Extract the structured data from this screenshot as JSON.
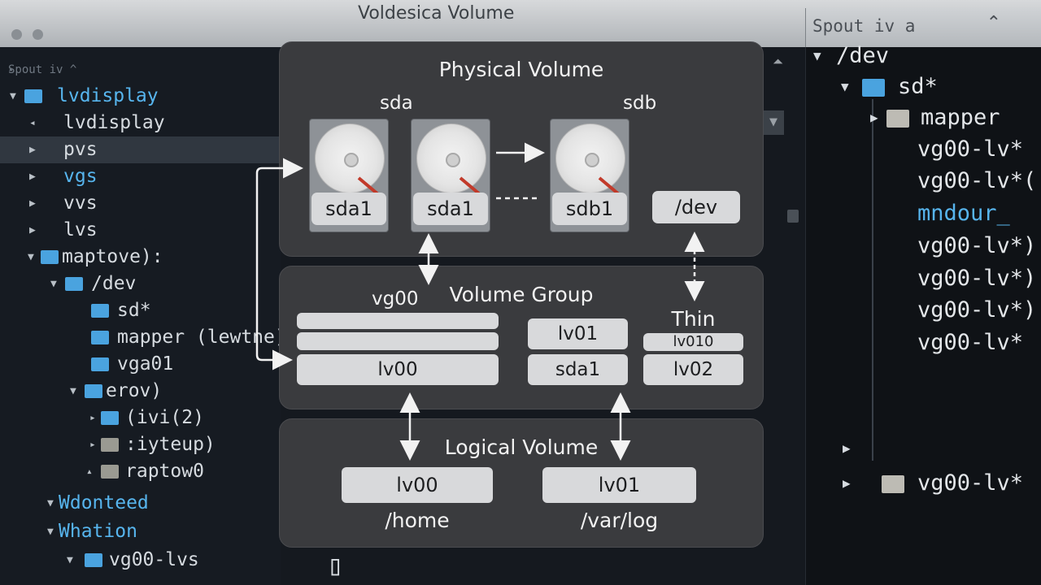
{
  "window": {
    "title": "Voldesica Volume"
  },
  "left_panel": {
    "header": "Spout iv ^",
    "rows": [
      {
        "label": "lvdisplay",
        "blue": true
      },
      {
        "label": "lvdisplay",
        "blue": false
      },
      {
        "label": "pvs",
        "blue": false
      },
      {
        "label": "vgs",
        "blue": true
      },
      {
        "label": "vvs",
        "blue": false
      },
      {
        "label": "lvs",
        "blue": false
      },
      {
        "label": "maptove):",
        "blue": false
      },
      {
        "label": "/dev",
        "blue": false
      },
      {
        "label": "sd*",
        "blue": false
      },
      {
        "label": "mapper (lewtne)",
        "blue": false
      },
      {
        "label": "vga01",
        "blue": false
      },
      {
        "label": "erov)",
        "blue": false
      },
      {
        "label": "(ivi(2)",
        "blue": false
      },
      {
        "label": ":iyteup)",
        "blue": false
      },
      {
        "label": "raptow0",
        "blue": false
      },
      {
        "label": "Wdonteed",
        "blue": true
      },
      {
        "label": "Whation",
        "blue": true
      },
      {
        "label": "vg00-lvs",
        "blue": false
      }
    ]
  },
  "diagram": {
    "physical": {
      "title": "Physical Volume",
      "sda_label": "sda",
      "sdb_label": "sdb",
      "partitions": [
        "sda1",
        "sda1",
        "sdb1"
      ],
      "dev_label": "/dev"
    },
    "group": {
      "title": "Volume Group",
      "vg_label": "vg00",
      "lv00_label": "lv00",
      "lv01_label": "lv01",
      "sda1_label": "sda1",
      "thin_label": "Thin",
      "lv010_label": "lv010",
      "lv02_label": "lv02"
    },
    "logical": {
      "title": "Logical Volume",
      "volumes": [
        {
          "name": "lv00",
          "mount": "/home"
        },
        {
          "name": "lv01",
          "mount": "/var/log"
        }
      ]
    }
  },
  "right_panel": {
    "header": "Spout iv a",
    "rows": [
      {
        "label": "/dev",
        "blue": false
      },
      {
        "label": "sd*",
        "blue": false
      },
      {
        "label": "mapper",
        "blue": false
      },
      {
        "label": "vg00-lv*",
        "blue": false
      },
      {
        "label": "vg00-lv*(",
        "blue": false
      },
      {
        "label": "mndour_",
        "blue": true
      },
      {
        "label": "vg00-lv*)",
        "blue": false
      },
      {
        "label": "vg00-lv*)",
        "blue": false
      },
      {
        "label": "vg00-lv*)",
        "blue": false
      },
      {
        "label": "vg00-lv*",
        "blue": false
      },
      {
        "label": "vg00-lv*",
        "blue": false
      }
    ]
  },
  "cursor_glyph": "▯"
}
